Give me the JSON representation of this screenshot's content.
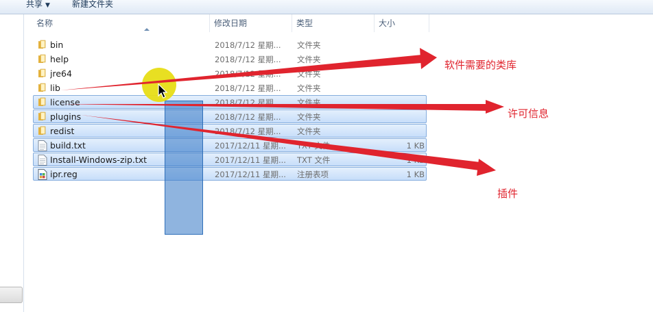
{
  "toolbar": {
    "share_label": "共享",
    "new_folder_label": "新建文件夹"
  },
  "columns": {
    "name": "名称",
    "date": "修改日期",
    "type": "类型",
    "size": "大小"
  },
  "files": [
    {
      "name": "bin",
      "date": "2018/7/12 星期...",
      "type": "文件夹",
      "size": "",
      "icon": "folder-icon",
      "selected": false
    },
    {
      "name": "help",
      "date": "2018/7/12 星期...",
      "type": "文件夹",
      "size": "",
      "icon": "folder-icon",
      "selected": false
    },
    {
      "name": "jre64",
      "date": "2018/7/12 星期...",
      "type": "文件夹",
      "size": "",
      "icon": "folder-icon",
      "selected": false
    },
    {
      "name": "lib",
      "date": "2018/7/12 星期...",
      "type": "文件夹",
      "size": "",
      "icon": "folder-icon",
      "selected": false
    },
    {
      "name": "license",
      "date": "2018/7/12 星期...",
      "type": "文件夹",
      "size": "",
      "icon": "folder-icon",
      "selected": true
    },
    {
      "name": "plugins",
      "date": "2018/7/12 星期...",
      "type": "文件夹",
      "size": "",
      "icon": "folder-icon",
      "selected": true
    },
    {
      "name": "redist",
      "date": "2018/7/12 星期...",
      "type": "文件夹",
      "size": "",
      "icon": "folder-icon",
      "selected": true
    },
    {
      "name": "build.txt",
      "date": "2017/12/11 星期...",
      "type": "TXT 文件",
      "size": "1 KB",
      "icon": "text-file-icon",
      "selected": true
    },
    {
      "name": "Install-Windows-zip.txt",
      "date": "2017/12/11 星期...",
      "type": "TXT 文件",
      "size": "1 KB",
      "icon": "text-file-icon",
      "selected": true
    },
    {
      "name": "ipr.reg",
      "date": "2017/12/11 星期...",
      "type": "注册表项",
      "size": "1 KB",
      "icon": "registry-file-icon",
      "selected": true
    }
  ],
  "annotations": {
    "lib_note": "软件需要的类库",
    "license_note": "许可信息",
    "plugins_note": "插件"
  },
  "colors": {
    "annotation_red": "#e0242e",
    "selection_border": "#84acdd",
    "marquee_blue": "#3377c4",
    "cursor_highlight": "#e7dd16"
  }
}
